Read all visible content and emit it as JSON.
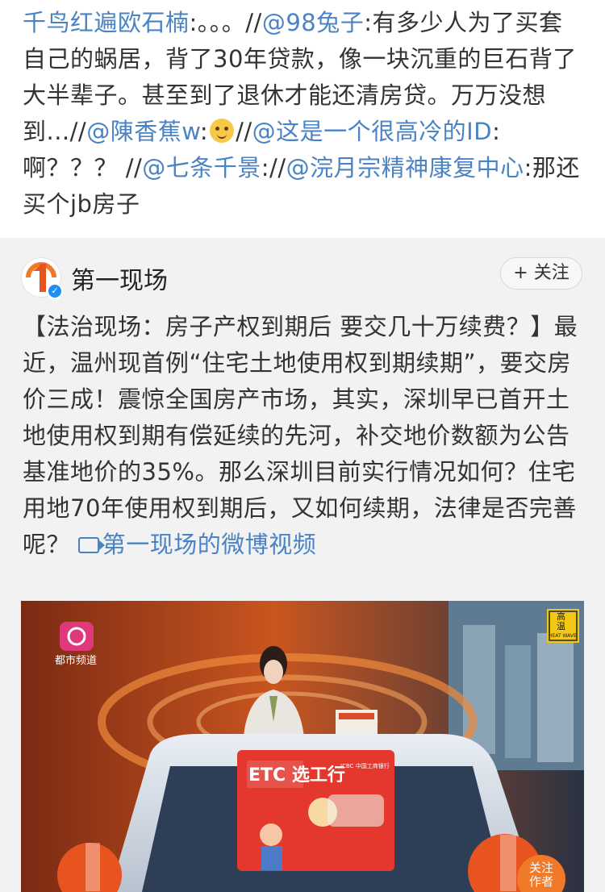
{
  "repost": {
    "segments": [
      {
        "t": "千鸟红遍欧石楠",
        "link": true
      },
      {
        "t": ":。。。//",
        "link": false
      },
      {
        "t": "@98兔子",
        "link": true
      },
      {
        "t": ":有多少人为了买套自己的蜗居，背了30年贷款，像一块沉重的巨石背了大半辈子。甚至到了退休才能还清房贷。万万没想到...//",
        "link": false
      },
      {
        "t": "@陳香蕉w",
        "link": true
      },
      {
        "t": ":",
        "link": false
      },
      {
        "emoji": "smiling-face-emoji"
      },
      {
        "t": "//",
        "link": false
      },
      {
        "t": "@这是一个很高冷的ID",
        "link": true
      },
      {
        "t": ":啊？？？ //",
        "link": false
      },
      {
        "t": "@七条千景",
        "link": true
      },
      {
        "t": "://",
        "link": false
      },
      {
        "t": "@浣月宗精神康复中心",
        "link": true
      },
      {
        "t": ":那还买个jb房子",
        "link": false
      }
    ]
  },
  "original_post": {
    "account_name": "第一现场",
    "avatar_icon": "number-one-logo",
    "verified_icon": "verified-badge-icon",
    "follow_label": "+ 关注",
    "text": "【法治现场：房子产权到期后 要交几十万续费？】最近，温州现首例“住宅土地使用权到期续期”，要交房价三成！震惊全国房产市场，其实，深圳早已首开土地使用权到期有偿延续的先河，补交地价数额为公告基准地价的35%。那么深圳目前实行情况如何？住宅用地70年使用权到期后，又如何续期，法律是否完善呢？",
    "video_link_icon": "video-icon",
    "video_link_text": "第一现场的微博视频"
  },
  "video": {
    "channel_logo_text": "都市频道",
    "heat_sign_top": "高温",
    "heat_sign_bottom": "HEAT WAVE",
    "screen_title": "ETC 选工行",
    "screen_bank": "ICBC 中国工商银行",
    "follow_author_line1": "关注",
    "follow_author_line2": "作者",
    "colors": {
      "accent": "#e8541f",
      "link": "#4a83c4"
    }
  }
}
